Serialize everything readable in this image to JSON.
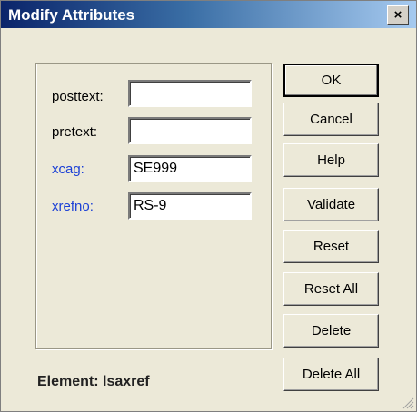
{
  "window": {
    "title": "Modify Attributes",
    "close_glyph": "×"
  },
  "fields": [
    {
      "label": "posttext:",
      "value": "",
      "color": "#000000"
    },
    {
      "label": "pretext:",
      "value": "",
      "color": "#000000"
    },
    {
      "label": "xcag:",
      "value": "SE999",
      "color": "#1a3fd6"
    },
    {
      "label": "xrefno:",
      "value": "RS-9",
      "color": "#1a3fd6"
    }
  ],
  "buttons": {
    "ok": "OK",
    "cancel": "Cancel",
    "help": "Help",
    "validate": "Validate",
    "reset": "Reset",
    "reset_all": "Reset All",
    "delete": "Delete",
    "delete_all": "Delete All"
  },
  "status": {
    "element": "Element: lsaxref"
  },
  "colors": {
    "title_start": "#0a246a",
    "title_end": "#a6caf0",
    "dialog_bg": "#ece9d8",
    "link_label": "#1a3fd6"
  }
}
